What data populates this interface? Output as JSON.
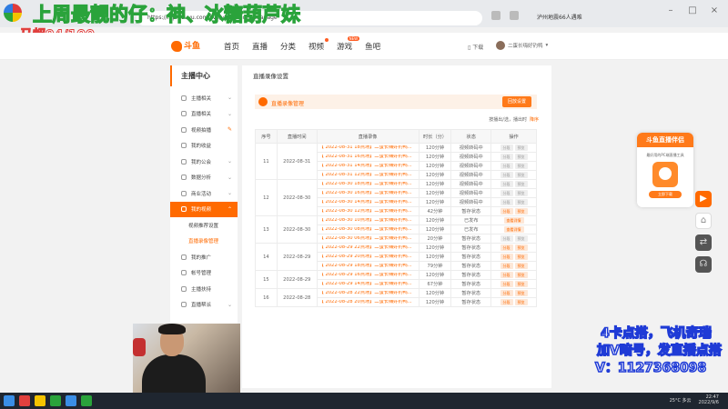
{
  "browser": {
    "tab_title": "直播录像设置",
    "url": "https://mp.douyu.com/live/video/video-manage",
    "ext_text": "泸州地震66人遇难"
  },
  "overlay": {
    "title": "上周最靓的仔：神、冰糖葫芦妹",
    "score": "马超94/100",
    "ad_line1": "4卡点搭，飞机奇瑞",
    "ad_line2": "加V暗号，发直播点搭",
    "ad_line3": "V：1127368098"
  },
  "header": {
    "logo_text": "斗鱼",
    "nav": [
      {
        "label": "首页"
      },
      {
        "label": "直播"
      },
      {
        "label": "分类"
      },
      {
        "label": "视频",
        "badge": ""
      },
      {
        "label": "游戏",
        "badge": "NEW"
      },
      {
        "label": "鱼吧"
      }
    ],
    "download": "下载",
    "username": "二蛋长嗨好钓鸭"
  },
  "sidebar": {
    "heading": "主播中心",
    "items": [
      {
        "label": "主播相关",
        "icon": "mic-icon"
      },
      {
        "label": "直播相关",
        "icon": "broadcast-icon"
      },
      {
        "label": "视频拍播",
        "icon": "video-icon"
      },
      {
        "label": "我的收益",
        "icon": "coin-icon"
      },
      {
        "label": "我的公会",
        "icon": "guild-icon"
      },
      {
        "label": "数据分析",
        "icon": "chart-icon"
      },
      {
        "label": "商业活动",
        "icon": "shop-icon"
      },
      {
        "label": "我的视频",
        "icon": "film-icon",
        "active": true
      }
    ],
    "sub_items": [
      {
        "label": "视频推荐设置"
      },
      {
        "label": "直播录像管理",
        "current": true
      }
    ],
    "items_after": [
      {
        "label": "我的推广",
        "icon": "promo-icon"
      },
      {
        "label": "帐号管理",
        "icon": "account-icon"
      },
      {
        "label": "主播扶持",
        "icon": "support-icon"
      },
      {
        "label": "直播帮派",
        "icon": "gang-icon"
      }
    ]
  },
  "panel": {
    "title": "直播录像设置",
    "section_label": "直播录像管理",
    "section_button": "回放设置",
    "sort_label": "按播出/选，播出时",
    "sort_value": "降序",
    "columns": [
      "序号",
      "直播时间",
      "直播录像",
      "时长（分）",
      "状态",
      "操作"
    ],
    "groups": [
      {
        "idx": "11",
        "date": "2022-08-31",
        "rows": [
          {
            "rec": "【 2022-08-31 18点场】二蛋长嗨好钓鸭...",
            "dur": "120分钟",
            "status": "视频转码中",
            "ops": [
              "分段",
              "预览"
            ],
            "hl": false
          },
          {
            "rec": "【 2022-08-31 16点场】二蛋长嗨好钓鸭...",
            "dur": "120分钟",
            "status": "视频转码中",
            "ops": [
              "分段",
              "预览"
            ],
            "hl": false
          },
          {
            "rec": "【 2022-08-31 14点场】二蛋长嗨好钓鸭...",
            "dur": "120分钟",
            "status": "视频转码中",
            "ops": [
              "分段",
              "预览"
            ],
            "hl": false
          },
          {
            "rec": "【 2022-08-31 12点场】二蛋长嗨好钓鸭...",
            "dur": "120分钟",
            "status": "视频转码中",
            "ops": [
              "分段",
              "预览"
            ],
            "hl": false
          }
        ]
      },
      {
        "idx": "12",
        "date": "2022-08-30",
        "rows": [
          {
            "rec": "【 2022-08-30 18点场】二蛋长嗨好钓鸭...",
            "dur": "120分钟",
            "status": "视频转码中",
            "ops": [
              "分段",
              "预览"
            ],
            "hl": false
          },
          {
            "rec": "【 2022-08-30 16点场】二蛋长嗨好钓鸭...",
            "dur": "120分钟",
            "status": "视频转码中",
            "ops": [
              "分段",
              "预览"
            ],
            "hl": false
          },
          {
            "rec": "【 2022-08-30 14点场】二蛋长嗨好钓鸭...",
            "dur": "120分钟",
            "status": "视频转码中",
            "ops": [
              "分段",
              "预览"
            ],
            "hl": false
          },
          {
            "rec": "【 2022-08-30 12点场】二蛋长嗨好钓鸭...",
            "dur": "42分钟",
            "status": "暂存状态",
            "ops": [
              "分段",
              "预览"
            ],
            "hl": true
          }
        ]
      },
      {
        "idx": "13",
        "date": "2022-08-30",
        "rows": [
          {
            "rec": "【 2022-08-30 10点场】二蛋长嗨好钓鸭...",
            "dur": "120分钟",
            "status": "已发布",
            "ops": [
              "查看详情"
            ],
            "hl": true
          },
          {
            "rec": "【 2022-08-30 08点场】二蛋长嗨好钓鸭...",
            "dur": "120分钟",
            "status": "已发布",
            "ops": [
              "查看详情"
            ],
            "hl": true
          },
          {
            "rec": "【 2022-08-30 06点场】二蛋长嗨好钓鸭...",
            "dur": "20分钟",
            "status": "暂存状态",
            "ops": [
              "分段",
              "预览"
            ],
            "hl": false
          }
        ]
      },
      {
        "idx": "14",
        "date": "2022-08-29",
        "rows": [
          {
            "rec": "【 2022-08-29 22点场】二蛋长嗨好钓鸭...",
            "dur": "120分钟",
            "status": "暂存状态",
            "ops": [
              "分段",
              "预览"
            ],
            "hl": true
          },
          {
            "rec": "【 2022-08-29 20点场】二蛋长嗨好钓鸭...",
            "dur": "120分钟",
            "status": "暂存状态",
            "ops": [
              "分段",
              "预览"
            ],
            "hl": true
          },
          {
            "rec": "【 2022-08-29 18点场】二蛋长嗨好钓鸭...",
            "dur": "79分钟",
            "status": "暂存状态",
            "ops": [
              "分段",
              "预览"
            ],
            "hl": true
          }
        ]
      },
      {
        "idx": "15",
        "date": "2022-08-29",
        "rows": [
          {
            "rec": "【 2022-08-29 16点场】二蛋长嗨好钓鸭...",
            "dur": "120分钟",
            "status": "暂存状态",
            "ops": [
              "分段",
              "预览"
            ],
            "hl": true
          },
          {
            "rec": "【 2022-08-29 14点场】二蛋长嗨好钓鸭...",
            "dur": "67分钟",
            "status": "暂存状态",
            "ops": [
              "分段",
              "预览"
            ],
            "hl": true
          }
        ]
      },
      {
        "idx": "16",
        "date": "2022-08-28",
        "rows": [
          {
            "rec": "【 2022-08-28 22点场】二蛋长嗨好钓鸭...",
            "dur": "120分钟",
            "status": "暂存状态",
            "ops": [
              "分段",
              "预览"
            ],
            "hl": true
          },
          {
            "rec": "【 2022-08-28 20点场】二蛋长嗨好钓鸭...",
            "dur": "120分钟",
            "status": "暂存状态",
            "ops": [
              "分段",
              "预览"
            ],
            "hl": true
          }
        ]
      }
    ]
  },
  "promo": {
    "heading": "斗鱼直播伴侣",
    "desc": "最好用的PC端直播工具",
    "app_label": "DOUYU",
    "button": "立即下载"
  },
  "taskbar": {
    "weather": "25°C 多云",
    "time": "22:47",
    "date": "2022/9/6"
  },
  "colors": {
    "accent": "#ff6a00",
    "overlay_blue": "#1f3bd6",
    "overlay_green": "#2aa33b"
  }
}
